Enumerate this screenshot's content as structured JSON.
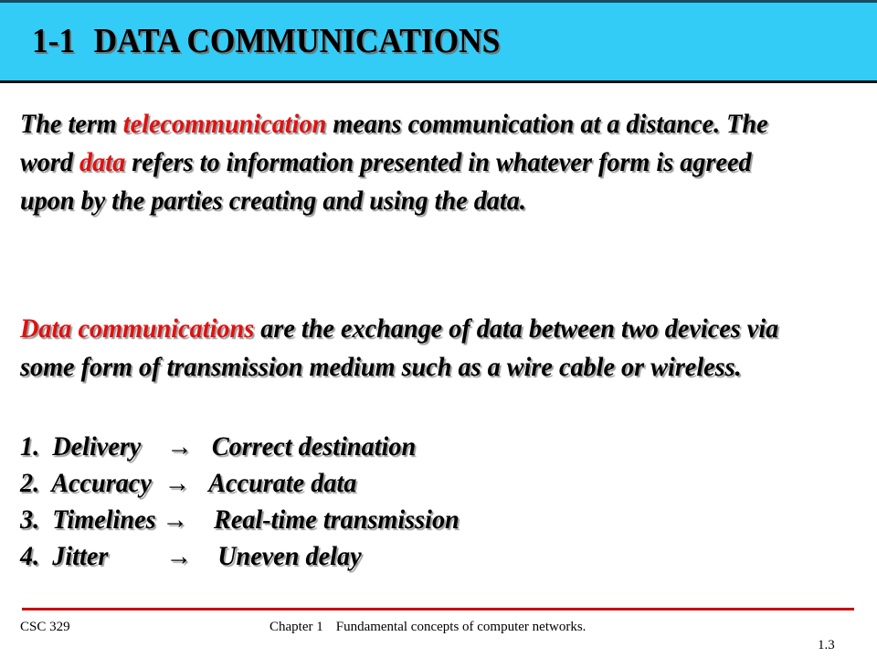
{
  "slide": {
    "header": {
      "section_number": "1-1",
      "section_title": "DATA COMMUNICATIONS",
      "band_color": "#33ccf6"
    },
    "body": {
      "paragraph_1": {
        "seg_1": "The term ",
        "seg_2_highlight": "telecommunication",
        "seg_3": " means communication at a distance. The word ",
        "seg_4_highlight": "data",
        "seg_5": " refers to information presented in whatever form is agreed upon by the parties creating and using the data."
      },
      "paragraph_2": {
        "seg_1_highlight": "Data communications",
        "seg_2": " are the exchange of data between two devices via some form of transmission medium such as a wire cable or wireless."
      },
      "highlight_color": "#e21010"
    },
    "list": {
      "items": [
        {
          "number": "1.",
          "term": "Delivery",
          "arrow": "→",
          "definition": "Correct destination",
          "line": "1.  Delivery    →   Correct destination"
        },
        {
          "number": "2.",
          "term": "Accuracy",
          "arrow": "→",
          "definition": "Accurate data",
          "line": "2.  Accuracy  →   Accurate data"
        },
        {
          "number": "3.",
          "term": "Timelines",
          "arrow": "→",
          "definition": "Real-time transmission",
          "line": "3.  Timelines →    Real-time transmission"
        },
        {
          "number": "4.",
          "term": "Jitter",
          "arrow": "→",
          "definition": "Uneven delay",
          "line": "4.  Jitter         →    Uneven delay"
        }
      ]
    },
    "footer": {
      "course_code": "CSC 329",
      "chapter": "Chapter 1",
      "chapter_title": "Fundamental concepts of computer networks.",
      "page_number": "1.3",
      "rule_color": "#cc0000"
    }
  }
}
